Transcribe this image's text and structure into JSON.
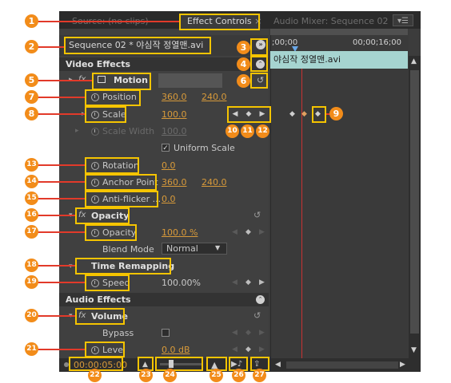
{
  "tabs": {
    "source": "Source: (no clips)",
    "effect_controls": "Effect Controls",
    "audio_mixer": "Audio Mixer: Sequence 02"
  },
  "header": {
    "sequence_clip": "Sequence 02 * 야심작 정열맨.avi",
    "time_start": ";00;00",
    "time_end": "00;00;16;00",
    "clip_name": "야심작 정열맨.avi"
  },
  "video_effects": {
    "section": "Video Effects",
    "motion": {
      "label": "Motion",
      "position": {
        "label": "Position",
        "x": "360.0",
        "y": "240.0"
      },
      "scale": {
        "label": "Scale",
        "value": "100.0"
      },
      "scale_width": {
        "label": "Scale Width",
        "value": "100.0"
      },
      "uniform_scale": "Uniform Scale",
      "rotation": {
        "label": "Rotation",
        "value": "0.0"
      },
      "anchor_point": {
        "label": "Anchor Point",
        "x": "360.0",
        "y": "240.0"
      },
      "anti_flicker": {
        "label": "Anti-flicker ...",
        "value": "0.0"
      }
    },
    "opacity": {
      "label": "Opacity",
      "param_label": "Opacity",
      "value": "100.0 %",
      "blend_mode_label": "Blend Mode",
      "blend_mode": "Normal"
    },
    "time_remapping": {
      "label": "Time Remapping",
      "speed_label": "Speed",
      "speed_value": "100.00%"
    }
  },
  "audio_effects": {
    "section": "Audio Effects",
    "volume": {
      "label": "Volume",
      "bypass_label": "Bypass",
      "level_label": "Level",
      "level_value": "0.0 dB"
    }
  },
  "footer": {
    "timecode": "00:00:05:00"
  },
  "callouts": [
    "1",
    "2",
    "3",
    "4",
    "5",
    "6",
    "7",
    "8",
    "9",
    "10",
    "11",
    "12",
    "13",
    "14",
    "15",
    "16",
    "17",
    "18",
    "19",
    "20",
    "21",
    "22",
    "23",
    "24",
    "25",
    "26",
    "27"
  ],
  "colors": {
    "badge": "#f28c1a",
    "highlight": "#f5c400",
    "leader": "#e23a2a",
    "panel": "#3c3c3c",
    "value": "#d89a3a"
  }
}
